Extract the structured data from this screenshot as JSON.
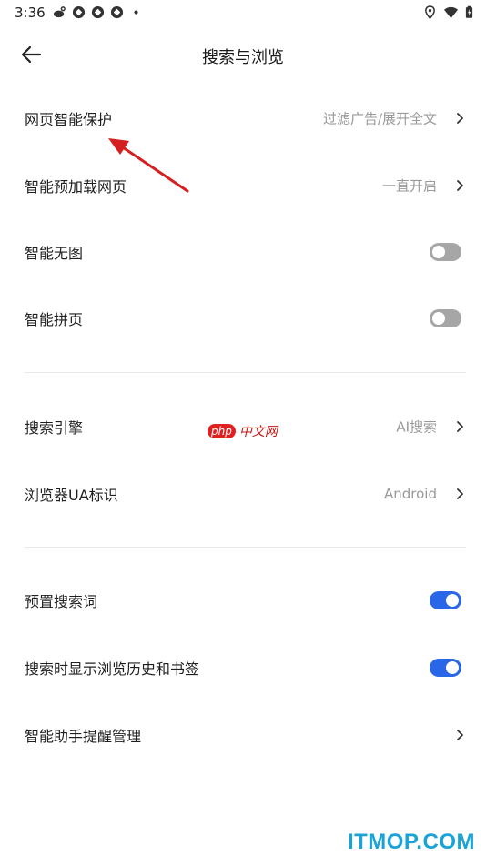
{
  "status_bar": {
    "time": "3:36",
    "left_icons": [
      "weibo-icon",
      "app-icon",
      "app-icon",
      "app-icon",
      "dot-icon"
    ],
    "right_icons": [
      "location-icon",
      "wifi-icon",
      "battery-icon"
    ]
  },
  "header": {
    "title": "搜索与浏览",
    "back_icon": "arrow-left-icon"
  },
  "settings": {
    "web_protection": {
      "label": "网页智能保护",
      "value": "过滤广告/展开全文"
    },
    "preload": {
      "label": "智能预加载网页",
      "value": "一直开启"
    },
    "no_image": {
      "label": "智能无图",
      "toggle": "off"
    },
    "page_merge": {
      "label": "智能拼页",
      "toggle": "off"
    },
    "search_engine": {
      "label": "搜索引擎",
      "value": "AI搜索"
    },
    "ua": {
      "label": "浏览器UA标识",
      "value": "Android"
    },
    "preset_words": {
      "label": "预置搜索词",
      "toggle": "on"
    },
    "show_history": {
      "label": "搜索时显示浏览历史和书签",
      "toggle": "on"
    },
    "assistant_reminder": {
      "label": "智能助手提醒管理"
    }
  },
  "watermarks": {
    "php_badge": "php",
    "php_text": "中文网",
    "site": "ITMOP.COM"
  },
  "colors": {
    "toggle_on": "#2a66e8",
    "toggle_off": "#a6a6a6",
    "annotation_arrow": "#d42020"
  }
}
